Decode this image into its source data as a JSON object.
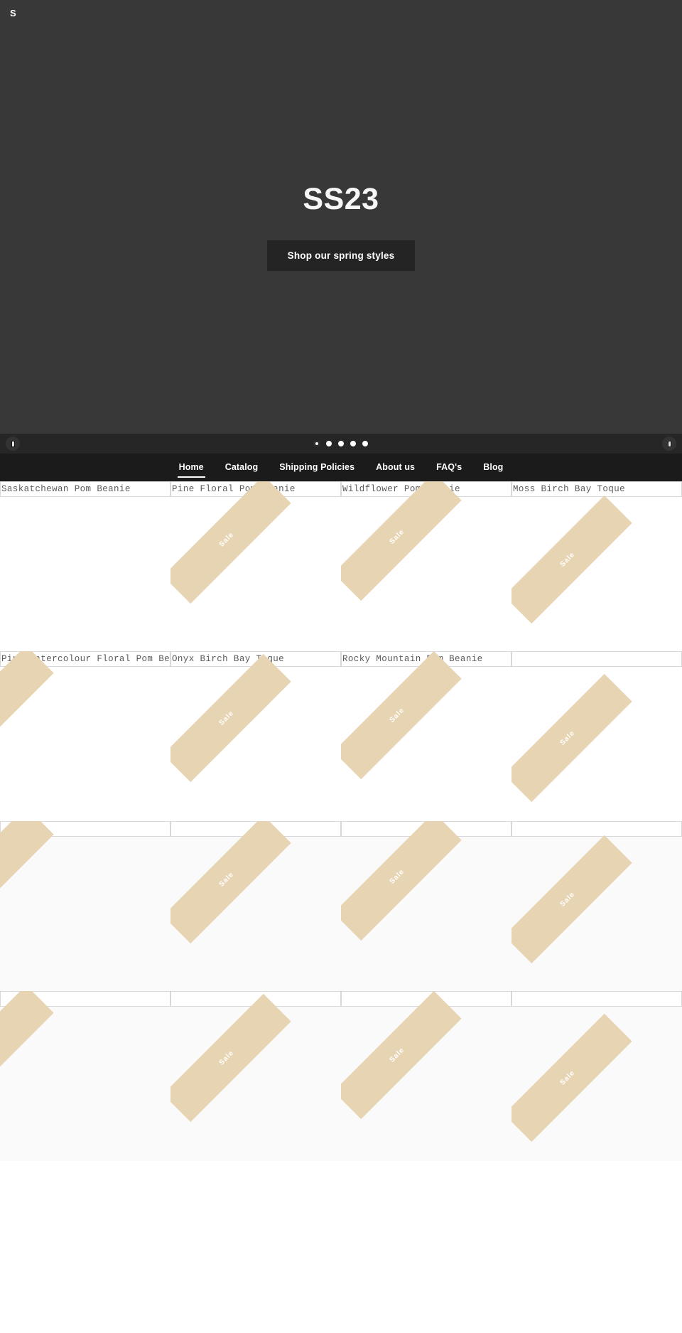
{
  "hero": {
    "logo": "S",
    "title": "SS23",
    "cta_label": "Shop our spring styles",
    "background_color": "#383838",
    "cta_color": "#242424"
  },
  "carousel": {
    "prev_label": "‹",
    "next_label": "›",
    "slide_count": 5,
    "active_slide": 1,
    "bar_color": "#262626"
  },
  "nav": {
    "items": [
      {
        "label": "Home",
        "active": true
      },
      {
        "label": "Catalog",
        "active": false
      },
      {
        "label": "Shipping Policies",
        "active": false
      },
      {
        "label": "About us",
        "active": false
      },
      {
        "label": "FAQ's",
        "active": false
      },
      {
        "label": "Blog",
        "active": false
      }
    ],
    "background_color": "#1b1b1b"
  },
  "badges": {
    "sale_label": "Sale",
    "sale_color": "#e7d4b2"
  },
  "sections": [
    {
      "name": "featured-row-1",
      "tinted": false,
      "products": [
        {
          "alt": "Saskatchewan Pom Beanie",
          "sale": false
        },
        {
          "alt": "Pine Floral Pom Beanie",
          "sale": true
        },
        {
          "alt": "Wildflower Pom Beanie",
          "sale": true
        },
        {
          "alt": "Moss Birch Bay Toque",
          "sale": true
        }
      ]
    },
    {
      "name": "featured-row-2",
      "tinted": false,
      "products": [
        {
          "alt": "Pink Watercolour Floral Pom Beanie",
          "sale": true
        },
        {
          "alt": "Onyx Birch Bay Toque",
          "sale": true
        },
        {
          "alt": "Rocky Mountain Pom Beanie",
          "sale": true
        },
        {
          "alt": "",
          "sale": true
        }
      ]
    },
    {
      "name": "featured-row-3",
      "tinted": true,
      "products": [
        {
          "alt": "",
          "sale": true
        },
        {
          "alt": "",
          "sale": true
        },
        {
          "alt": "",
          "sale": true
        },
        {
          "alt": "",
          "sale": true
        }
      ]
    },
    {
      "name": "featured-row-4",
      "tinted": true,
      "products": [
        {
          "alt": "",
          "sale": true
        },
        {
          "alt": "",
          "sale": true
        },
        {
          "alt": "",
          "sale": true
        },
        {
          "alt": "",
          "sale": true
        }
      ]
    }
  ]
}
